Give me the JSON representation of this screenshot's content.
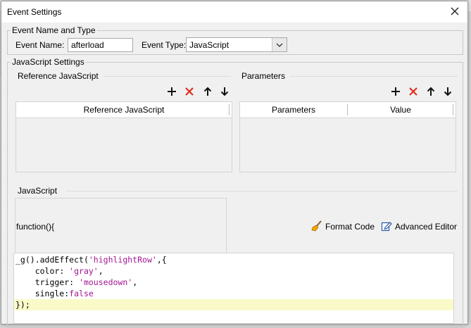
{
  "dialog": {
    "title": "Event Settings"
  },
  "event_name_type": {
    "legend": "Event Name and Type",
    "name_label": "Event Name:",
    "name_value": "afterload",
    "type_label": "Event Type:",
    "type_value": "JavaScript"
  },
  "js_settings": {
    "legend": "JavaScript Settings",
    "reference": {
      "title": "Reference JavaScript",
      "column": "Reference JavaScript"
    },
    "parameters": {
      "title": "Parameters",
      "columns": [
        "Parameters",
        "Value"
      ]
    },
    "javascript": {
      "title": "JavaScript",
      "function_prefix": "function(){",
      "format_code_label": "Format Code",
      "advanced_editor_label": "Advanced Editor"
    }
  },
  "code": {
    "line1": {
      "a": "_g",
      "b": "().addEffect(",
      "c": "'highlightRow'",
      "d": ",{"
    },
    "line2": {
      "key": "    color",
      "sep": ": ",
      "val": "'gray'",
      "end": ","
    },
    "line3": {
      "key": "    trigger",
      "sep": ": ",
      "val": "'mousedown'",
      "end": ","
    },
    "line4": {
      "key": "    single",
      "sep": ":",
      "val": "false"
    },
    "line5": "});"
  },
  "icons": {
    "close": "close-icon",
    "add": "plus-icon",
    "delete": "red-x-icon",
    "move_up": "arrow-up-icon",
    "move_down": "arrow-down-icon",
    "format": "broom-icon",
    "advanced": "edit-icon"
  },
  "colors": {
    "delete_red": "#e0301e",
    "code_string": "#a31593",
    "highlight_line": "#fafac8"
  }
}
